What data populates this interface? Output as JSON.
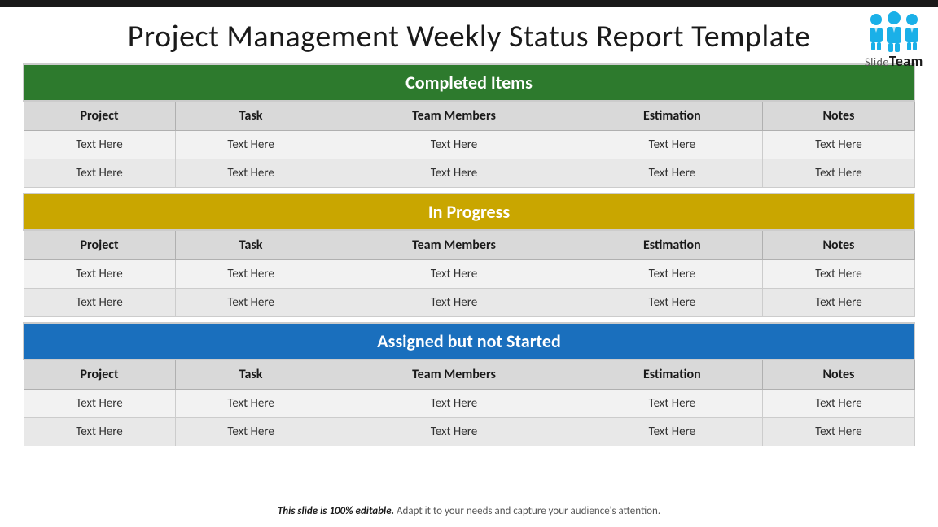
{
  "topBar": {},
  "header": {
    "title": "Project Management Weekly Status Report Template"
  },
  "logo": {
    "text": "Team",
    "sideText": "Slide"
  },
  "sections": [
    {
      "id": "completed",
      "headerText": "Completed Items",
      "colorClass": "completed",
      "columns": [
        "Project",
        "Task",
        "Team Members",
        "Estimation",
        "Notes"
      ],
      "rows": [
        [
          "Text Here",
          "Text Here",
          "Text Here",
          "Text Here",
          "Text Here"
        ],
        [
          "Text Here",
          "Text Here",
          "Text Here",
          "Text Here",
          "Text Here"
        ]
      ]
    },
    {
      "id": "in-progress",
      "headerText": "In Progress",
      "colorClass": "in-progress",
      "columns": [
        "Project",
        "Task",
        "Team Members",
        "Estimation",
        "Notes"
      ],
      "rows": [
        [
          "Text Here",
          "Text Here",
          "Text Here",
          "Text Here",
          "Text Here"
        ],
        [
          "Text Here",
          "Text Here",
          "Text Here",
          "Text Here",
          "Text Here"
        ]
      ]
    },
    {
      "id": "assigned",
      "headerText": "Assigned but not Started",
      "colorClass": "assigned",
      "columns": [
        "Project",
        "Task",
        "Team Members",
        "Estimation",
        "Notes"
      ],
      "rows": [
        [
          "Text Here",
          "Text Here",
          "Text Here",
          "Text Here",
          "Text Here"
        ],
        [
          "Text Here",
          "Text Here",
          "Text Here",
          "Text Here",
          "Text Here"
        ]
      ]
    }
  ],
  "footer": {
    "boldText": "This slide is 100% editable.",
    "normalText": " Adapt it to your needs and capture your audience's attention."
  }
}
